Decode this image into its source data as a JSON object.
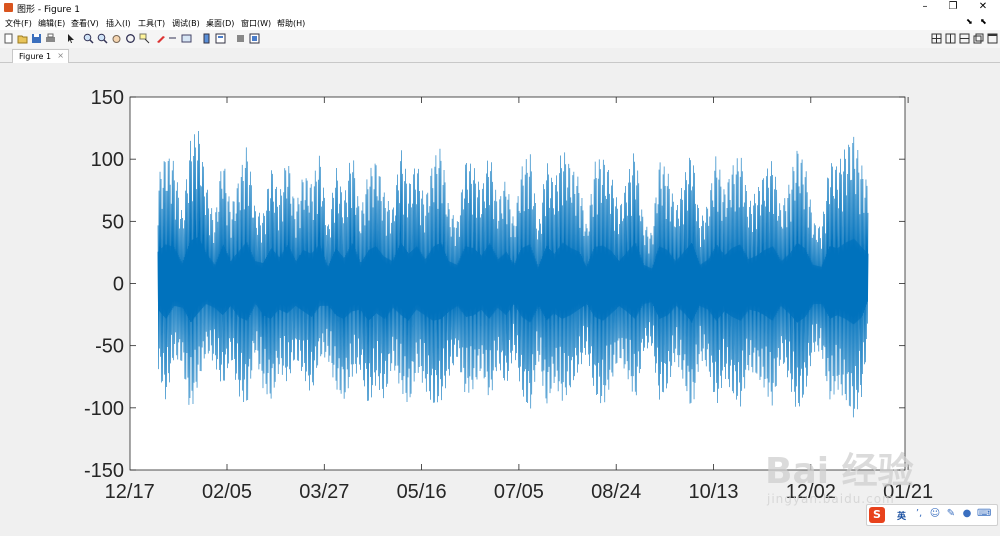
{
  "window": {
    "title": "图形 - Figure 1",
    "controls": [
      "–",
      "❐",
      "✕"
    ]
  },
  "menu": {
    "items": [
      "文件(F)",
      "编辑(E)",
      "查看(V)",
      "插入(I)",
      "工具(T)",
      "调试(B)",
      "桌面(D)",
      "窗口(W)",
      "帮助(H)"
    ]
  },
  "toolbar": {
    "icons": [
      "new-figure-icon",
      "open-file-icon",
      "save-icon",
      "print-icon",
      "pointer-icon",
      "zoom-in-icon",
      "zoom-out-icon",
      "pan-icon",
      "rotate-icon",
      "data-cursor-icon",
      "brush-icon",
      "link-icon",
      "colorbar-icon",
      "legend-icon",
      "hide-plot-tools-icon",
      "show-plot-tools-icon"
    ],
    "layout_icons": [
      "tile-icon",
      "left-right-icon",
      "top-bottom-icon",
      "float-icon",
      "maximize-icon"
    ]
  },
  "tab": {
    "label": "Figure 1",
    "close": "×"
  },
  "chart_data": {
    "type": "line",
    "color": "#0072BD",
    "ylim": [
      -150,
      150
    ],
    "yticks": [
      "150",
      "100",
      "50",
      "0",
      "-50",
      "-100",
      "-150"
    ],
    "xticks": [
      "12/17",
      "02/05",
      "03/27",
      "05/16",
      "07/05",
      "08/24",
      "10/13",
      "12/02",
      "01/21"
    ],
    "x_start": "12/27",
    "x_end": "12/28",
    "series": [
      {
        "envelope": [
          [
            0,
            85
          ],
          [
            8,
            105
          ],
          [
            16,
            98
          ],
          [
            24,
            55
          ],
          [
            32,
            115
          ],
          [
            40,
            125
          ],
          [
            48,
            80
          ],
          [
            56,
            50
          ],
          [
            64,
            105
          ],
          [
            72,
            60
          ],
          [
            80,
            85
          ],
          [
            88,
            112
          ],
          [
            96,
            60
          ],
          [
            104,
            55
          ],
          [
            112,
            95
          ],
          [
            120,
            70
          ],
          [
            128,
            105
          ],
          [
            136,
            60
          ],
          [
            144,
            90
          ],
          [
            152,
            80
          ],
          [
            160,
            105
          ],
          [
            168,
            45
          ],
          [
            176,
            95
          ],
          [
            184,
            68
          ],
          [
            192,
            110
          ],
          [
            200,
            55
          ],
          [
            208,
            90
          ],
          [
            216,
            100
          ],
          [
            224,
            72
          ],
          [
            232,
            60
          ],
          [
            240,
            110
          ],
          [
            248,
            80
          ],
          [
            256,
            100
          ],
          [
            264,
            65
          ],
          [
            272,
            100
          ],
          [
            280,
            110
          ],
          [
            288,
            60
          ],
          [
            296,
            50
          ],
          [
            304,
            100
          ],
          [
            312,
            95
          ],
          [
            320,
            75
          ],
          [
            328,
            108
          ],
          [
            336,
            65
          ],
          [
            344,
            85
          ],
          [
            352,
            50
          ],
          [
            360,
            95
          ],
          [
            368,
            105
          ],
          [
            376,
            45
          ],
          [
            384,
            100
          ],
          [
            392,
            80
          ],
          [
            400,
            110
          ],
          [
            408,
            95
          ],
          [
            416,
            85
          ],
          [
            424,
            45
          ],
          [
            432,
            98
          ],
          [
            440,
            102
          ],
          [
            448,
            88
          ],
          [
            456,
            60
          ],
          [
            464,
            85
          ],
          [
            472,
            110
          ],
          [
            480,
            50
          ],
          [
            488,
            40
          ],
          [
            496,
            100
          ],
          [
            504,
            90
          ],
          [
            512,
            60
          ],
          [
            520,
            85
          ],
          [
            528,
            110
          ],
          [
            536,
            50
          ],
          [
            544,
            65
          ],
          [
            552,
            105
          ],
          [
            560,
            75
          ],
          [
            568,
            95
          ],
          [
            576,
            105
          ],
          [
            584,
            65
          ],
          [
            592,
            75
          ],
          [
            600,
            90
          ],
          [
            608,
            100
          ],
          [
            616,
            60
          ],
          [
            624,
            80
          ],
          [
            632,
            110
          ],
          [
            640,
            95
          ],
          [
            648,
            50
          ],
          [
            656,
            45
          ],
          [
            664,
            100
          ],
          [
            672,
            95
          ],
          [
            680,
            110
          ],
          [
            688,
            120
          ],
          [
            696,
            95
          ],
          [
            702,
            80
          ]
        ],
        "min_envelope": [
          [
            0,
            -70
          ],
          [
            8,
            -95
          ],
          [
            16,
            -60
          ],
          [
            24,
            -65
          ],
          [
            32,
            -105
          ],
          [
            40,
            -80
          ],
          [
            48,
            -55
          ],
          [
            56,
            -65
          ],
          [
            64,
            -85
          ],
          [
            72,
            -60
          ],
          [
            80,
            -90
          ],
          [
            88,
            -100
          ],
          [
            96,
            -55
          ],
          [
            104,
            -85
          ],
          [
            112,
            -95
          ],
          [
            120,
            -70
          ],
          [
            128,
            -80
          ],
          [
            136,
            -60
          ],
          [
            144,
            -75
          ],
          [
            152,
            -90
          ],
          [
            160,
            -60
          ],
          [
            168,
            -60
          ],
          [
            176,
            -85
          ],
          [
            184,
            -95
          ],
          [
            192,
            -75
          ],
          [
            200,
            -70
          ],
          [
            208,
            -100
          ],
          [
            216,
            -80
          ],
          [
            224,
            -95
          ],
          [
            232,
            -65
          ],
          [
            240,
            -85
          ],
          [
            248,
            -100
          ],
          [
            256,
            -70
          ],
          [
            264,
            -85
          ],
          [
            272,
            -100
          ],
          [
            280,
            -95
          ],
          [
            288,
            -75
          ],
          [
            296,
            -60
          ],
          [
            304,
            -90
          ],
          [
            312,
            -85
          ],
          [
            320,
            -70
          ],
          [
            328,
            -95
          ],
          [
            336,
            -65
          ],
          [
            344,
            -85
          ],
          [
            352,
            -55
          ],
          [
            360,
            -90
          ],
          [
            368,
            -105
          ],
          [
            376,
            -60
          ],
          [
            384,
            -100
          ],
          [
            392,
            -80
          ],
          [
            400,
            -95
          ],
          [
            408,
            -85
          ],
          [
            416,
            -70
          ],
          [
            424,
            -55
          ],
          [
            432,
            -90
          ],
          [
            440,
            -100
          ],
          [
            448,
            -80
          ],
          [
            456,
            -60
          ],
          [
            464,
            -75
          ],
          [
            472,
            -95
          ],
          [
            480,
            -55
          ],
          [
            488,
            -50
          ],
          [
            496,
            -95
          ],
          [
            504,
            -85
          ],
          [
            512,
            -60
          ],
          [
            520,
            -80
          ],
          [
            528,
            -105
          ],
          [
            536,
            -60
          ],
          [
            544,
            -70
          ],
          [
            552,
            -100
          ],
          [
            560,
            -75
          ],
          [
            568,
            -90
          ],
          [
            576,
            -100
          ],
          [
            584,
            -70
          ],
          [
            592,
            -75
          ],
          [
            600,
            -85
          ],
          [
            608,
            -100
          ],
          [
            616,
            -60
          ],
          [
            624,
            -80
          ],
          [
            632,
            -105
          ],
          [
            640,
            -90
          ],
          [
            648,
            -55
          ],
          [
            656,
            -55
          ],
          [
            664,
            -95
          ],
          [
            672,
            -85
          ],
          [
            680,
            -95
          ],
          [
            688,
            -110
          ],
          [
            696,
            -90
          ],
          [
            702,
            -45
          ]
        ]
      }
    ],
    "grid": false,
    "legend": "none"
  },
  "ime": {
    "logo": "S",
    "lang": "英",
    "icons": [
      "punct-icon",
      "smile-icon",
      "pen-icon",
      "mic-icon",
      "keyboard-icon",
      "skin-icon"
    ]
  },
  "watermark": {
    "main": "Bai 经验",
    "sub": "jingyan.baidu.com"
  }
}
